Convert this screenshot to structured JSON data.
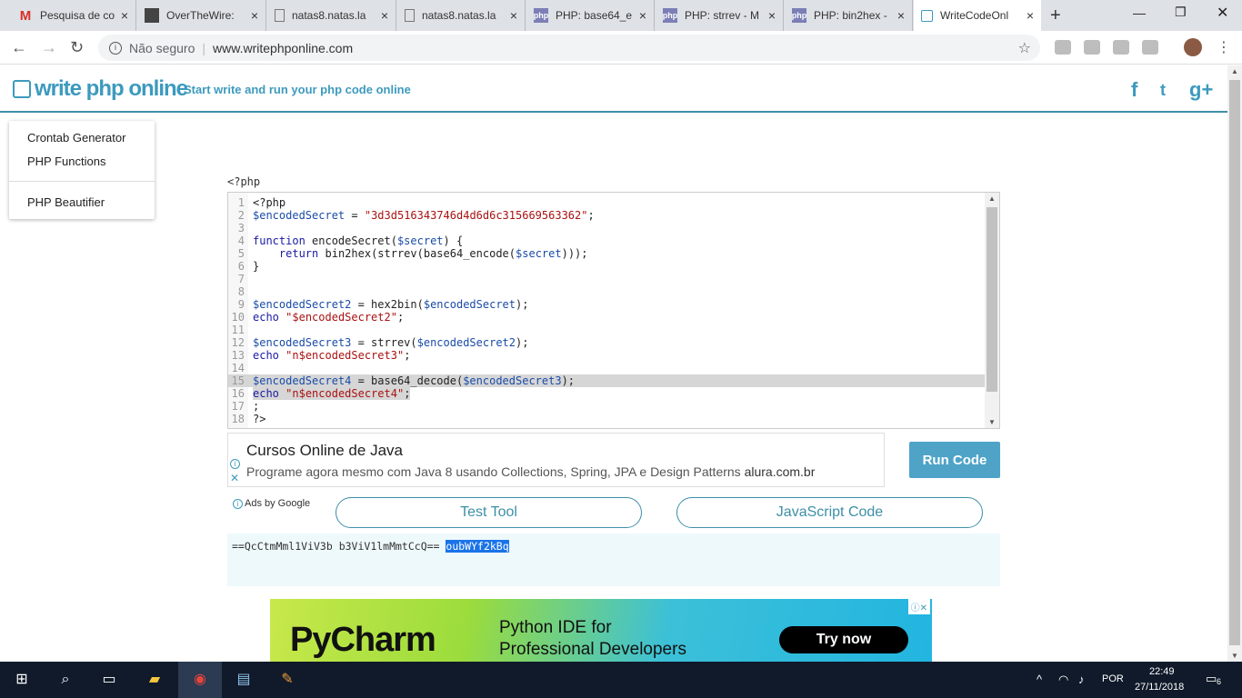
{
  "browser": {
    "tabs": [
      {
        "title": "Pesquisa de co",
        "icon": "gmail-icon"
      },
      {
        "title": "OverTheWire: ",
        "icon": "overthewire-icon"
      },
      {
        "title": "natas8.natas.la",
        "icon": "document-icon"
      },
      {
        "title": "natas8.natas.la",
        "icon": "document-icon"
      },
      {
        "title": "PHP: base64_e",
        "icon": "php-icon"
      },
      {
        "title": "PHP: strrev - M",
        "icon": "php-icon"
      },
      {
        "title": "PHP: bin2hex -",
        "icon": "php-icon"
      },
      {
        "title": "WriteCodeOnl",
        "icon": "writecode-icon",
        "active": true
      }
    ],
    "address": {
      "security": "Não seguro",
      "url": "www.writephponline.com"
    }
  },
  "site": {
    "logo": "write php online",
    "tagline": "- Start write and run your php code online",
    "social": [
      "f",
      "t",
      "g+"
    ],
    "brand_color": "#3d9abe"
  },
  "sidemenu": {
    "items": [
      "Crontab Generator",
      "PHP Functions",
      "PHP Beautifier"
    ]
  },
  "editor": {
    "label": "<?php",
    "lines": [
      "<?php",
      "$encodedSecret = \"3d3d516343746d4d6d6c315669563362\";",
      "",
      "function encodeSecret($secret) {",
      "    return bin2hex(strrev(base64_encode($secret)));",
      "}",
      "",
      "",
      "$encodedSecret2 = hex2bin($encodedSecret);",
      "echo \"$encodedSecret2\";",
      "",
      "$encodedSecret3 = strrev($encodedSecret2);",
      "echo \"n$encodedSecret3\";",
      "",
      "$encodedSecret4 = base64_decode($encodedSecret3);",
      "echo \"n$encodedSecret4\";",
      ";",
      "?>"
    ]
  },
  "ad": {
    "title": "Cursos Online de Java",
    "body": "Programe agora mesmo com Java 8 usando Collections, Spring, JPA e Design Patterns",
    "domain": "alura.com.br",
    "ads_by": "Ads by Google"
  },
  "buttons": {
    "run": "Run Code",
    "test_tool": "Test Tool",
    "javascript": "JavaScript Code"
  },
  "output": {
    "text": "==QcCtmMml1ViV3b b3ViV1lmMmtCcQ== ",
    "selected": "oubWYf2kBq"
  },
  "banner": {
    "brand": "PyCharm",
    "tagline_1": "Python IDE for",
    "tagline_2": "Professional Developers",
    "cta": "Try now"
  },
  "taskbar": {
    "lang": "POR",
    "time": "22:49",
    "date": "27/11/2018",
    "notifications": "6"
  }
}
